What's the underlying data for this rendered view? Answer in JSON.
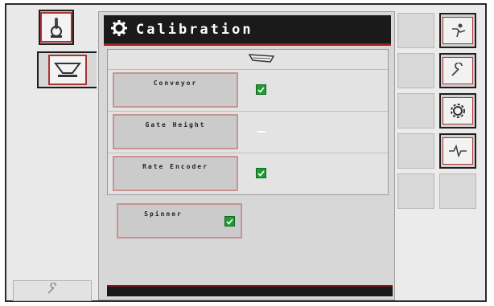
{
  "title": "Calibration",
  "items": [
    {
      "label": "Conveyor",
      "state": "checked"
    },
    {
      "label": "Gate Height",
      "state": "none"
    },
    {
      "label": "Rate Encoder",
      "state": "checked"
    }
  ],
  "spinner": {
    "label": "Spinner",
    "state": "checked"
  },
  "left_tabs": [
    {
      "icon": "joystick-icon"
    },
    {
      "icon": "spreader-hopper-icon"
    }
  ],
  "left_bottom_icon": "wrench-icon",
  "right_buttons": [
    {
      "icon": "operator-settings-icon"
    },
    {
      "icon": "wrench-icon"
    },
    {
      "icon": "gear-icon"
    },
    {
      "icon": "diagnostics-pulse-icon"
    }
  ],
  "colors": {
    "title_bar": "#1a1a1a",
    "accent": "#a01e1e",
    "check": "#1f9c33"
  }
}
